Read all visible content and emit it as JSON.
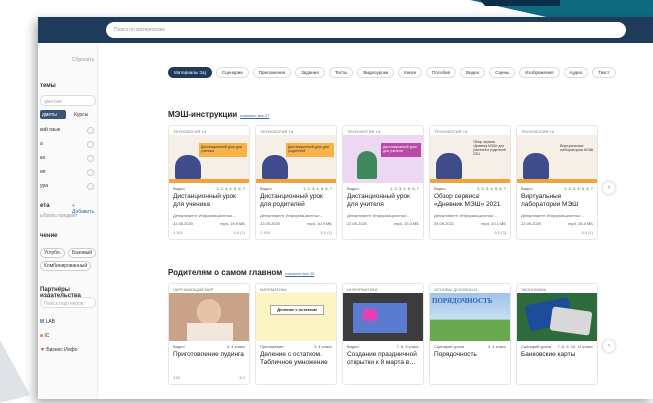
{
  "search": {
    "placeholder": "Поиск по материалам"
  },
  "sidebar": {
    "reset": "Сбросить",
    "themes_heading": "темы",
    "search_subject_placeholder": "дметам",
    "row_a": "дметы",
    "row_b": "Курсы",
    "subjects": [
      {
        "label": "кий язык"
      },
      {
        "label": "а"
      },
      {
        "label": "ка"
      },
      {
        "label": "ия"
      },
      {
        "label": "ура"
      }
    ],
    "subjects_heading": "ета",
    "add_label": "+ Добавить",
    "add_hint": "ыбрать предмет",
    "level_heading": "чение",
    "levels": [
      "Углубл.",
      "Базовый",
      "Комбинированный"
    ],
    "partners_heading": "Партнёры издательства",
    "partners_search": "Поиск партнеров",
    "partners": [
      {
        "name": "LAB"
      },
      {
        "name": "IC"
      },
      {
        "name": "Бизнес Инфо"
      }
    ]
  },
  "chips": [
    "Материалы ЭЦ",
    "Сценарии",
    "Приложения",
    "Задания",
    "Тесты",
    "Видеоуроки",
    "Книги",
    "Пособия",
    "Видео",
    "Сцены",
    "Изображения",
    "Аудио",
    "Текст"
  ],
  "section1": {
    "title": "МЭШ-инструкции",
    "link": "показать все 27",
    "cards": [
      {
        "cat": "ТЕХНОЛОГИЯ",
        "count": "+4",
        "type": "Видео",
        "grades": "1, 2, 3, 4, 5, 6, 7",
        "title": "Дистанционный урок для ученика",
        "dept": "Департамент Информационных…",
        "date": "22.05.2020",
        "size": "mp4, 19.9 МБ",
        "views": "1 301",
        "rating": "4.9 (2)",
        "banner": "Дистанционный урок для ученика"
      },
      {
        "cat": "ТЕХНОЛОГИЯ",
        "count": "+4",
        "type": "Видео",
        "grades": "1, 2, 3, 4, 5, 6, 7",
        "title": "Дистанционный урок для родителей",
        "dept": "Департамент Информационных…",
        "date": "22.05.2020",
        "size": "mp4, 10.9 МБ",
        "views": "1 450",
        "rating": "5.0 (1)",
        "banner": "Дистанционный урок для родителей"
      },
      {
        "cat": "ТЕХНОЛОГИЯ",
        "count": "+4",
        "type": "Видео",
        "grades": "1, 2, 3, 4, 5, 6, 7",
        "title": "Дистанционный урок для учителя",
        "dept": "Департамент Информационных…",
        "date": "22.05.2020",
        "size": "mp4, 15.3 МБ",
        "views": "",
        "rating": "",
        "banner": "Дистанционный урок для учителя"
      },
      {
        "cat": "ТЕХНОЛОГИЯ",
        "count": "+4",
        "type": "Видео",
        "grades": "1, 2, 3, 4, 5, 6, 7",
        "title": "Обзор сервиса «Дневник МЭШ» 2021",
        "dept": "Департамент Информационных…",
        "date": "25.08.2021",
        "size": "mp4, 20.1 МБ",
        "views": "",
        "rating": "5.0 (3)",
        "banner": "Обзор сервиса «Дневник МЭШ» для учителей и родителей 2021"
      },
      {
        "cat": "ТЕХНОЛОГИЯ",
        "count": "+4",
        "type": "Видео",
        "grades": "1, 2, 3, 4, 5, 6, 7",
        "title": "Виртуальные лаборатории МЭШ",
        "dept": "Департамент Информационных…",
        "date": "22.05.2020",
        "size": "mp4, 28.4 МБ",
        "views": "",
        "rating": "5.0 (1)",
        "banner": "Виртуальные лаборатории МЭШ"
      }
    ]
  },
  "section2": {
    "title": "Родителям о самом главном",
    "link": "показать все 20",
    "cards": [
      {
        "cat": "ОКРУЖАЮЩИЙ МИР",
        "type": "Видео",
        "grades": "3, 4 класс",
        "title": "Приготовление пудинга",
        "views": "215",
        "rating": "5.0"
      },
      {
        "cat": "МАТЕМАТИКА",
        "type": "Приложение",
        "grades": "3, 4 класс",
        "title": "Деление с остатком. Табличное умножение",
        "banner": "Деление с остатком",
        "views": "",
        "rating": ""
      },
      {
        "cat": "ИНФОРМАТИКА",
        "type": "Видео",
        "grades": "7, 8, 9 класс",
        "title": "Создание праздничной открытки к 8 марта в…",
        "views": "",
        "rating": ""
      },
      {
        "cat": "ОСНОВЫ ДУХОВНО-Н…",
        "type": "Сценарий урока",
        "grades": "3, 4 класс",
        "title": "Порядочность",
        "banner": "ПОРЯДОЧНОСТЬ",
        "views": "",
        "rating": ""
      },
      {
        "cat": "ЭКОНОМИКА",
        "type": "Сценарий урока",
        "grades": "7, 8, 9, 10, 11 класс",
        "title": "Банковские карты",
        "views": "",
        "rating": ""
      }
    ]
  }
}
